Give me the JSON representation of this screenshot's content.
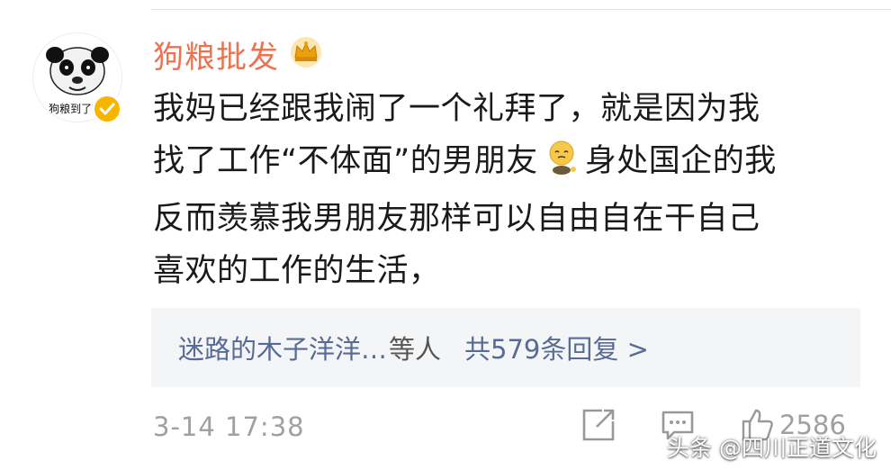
{
  "comment": {
    "user": {
      "name": "狗粮批发",
      "avatar_caption": "狗粮到了 你",
      "badge_icon": "crown-icon",
      "verified": true
    },
    "body_lines": [
      "我妈已经跟我闹了一个礼拜了，就是因为我",
      "找了工作“不体面”的男朋友",
      "身处国企的我",
      "反而羡慕我男朋友那样可以自由自在干自己",
      "喜欢的工作的生活，"
    ],
    "inline_emoji": "wilted-face-emoji",
    "replies": {
      "users_text": "迷路的木子洋洋…",
      "suffix": "等人",
      "count_text": "共579条回复 >"
    },
    "timestamp": "3-14 17:38",
    "actions": {
      "share_icon": "share-icon",
      "comment_icon": "comment-icon",
      "like_icon": "like-icon",
      "like_count": "2586"
    }
  },
  "watermark": "头条 @四川正道文化",
  "colors": {
    "username": "#eb7350",
    "link": "#586b95",
    "meta": "#a0a0a0",
    "reply_bg": "#f4f5f7",
    "badge": "#f7b500"
  }
}
